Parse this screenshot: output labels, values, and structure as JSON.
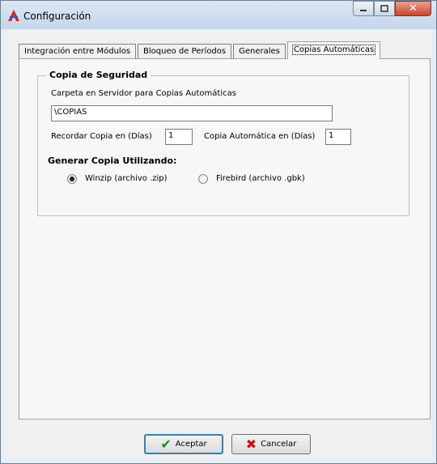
{
  "window": {
    "title": "Configuración",
    "icon": "app-logo-icon"
  },
  "tabs": [
    {
      "label": "Integración entre Módulos"
    },
    {
      "label": "Bloqueo de Períodos"
    },
    {
      "label": "Generales"
    },
    {
      "label": "Copias Automáticas",
      "active": true
    }
  ],
  "backup": {
    "group_title": "Copia de Seguridad",
    "folder_label": "Carpeta en Servidor para Copias Automáticas",
    "folder_value": "\\COPIAS",
    "remember_label": "Recordar Copia en (Días)",
    "remember_value": "1",
    "auto_label": "Copia Automática en (Días)",
    "auto_value": "1",
    "generate_label": "Generar Copia Utilizando:",
    "options": [
      {
        "label": "Winzip (archivo .zip)",
        "selected": true
      },
      {
        "label": "Firebird (archivo .gbk)",
        "selected": false
      }
    ]
  },
  "buttons": {
    "accept": "Aceptar",
    "cancel": "Cancelar"
  },
  "colors": {
    "accept_icon": "#1a8a1a",
    "cancel_icon": "#c01818",
    "close_button": "#c8442b"
  }
}
